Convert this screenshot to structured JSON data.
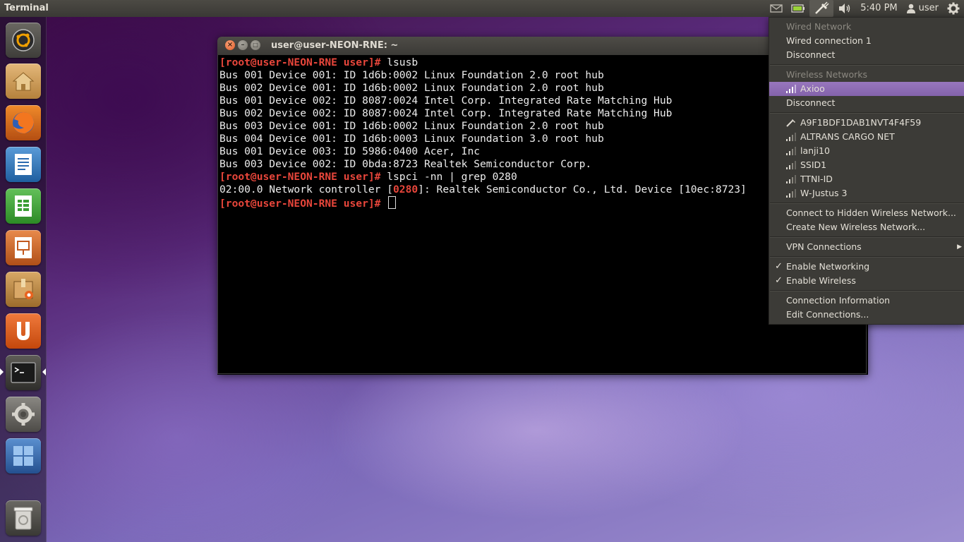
{
  "top_panel": {
    "app_title": "Terminal",
    "time": "5:40 PM",
    "user": "user",
    "icons": [
      "mail-icon",
      "battery-icon",
      "network-icon",
      "volume-icon",
      "user-icon",
      "gear-icon"
    ]
  },
  "launcher": {
    "items": [
      {
        "name": "dash-home",
        "icon": "ubuntu-logo-icon"
      },
      {
        "name": "home-folder",
        "icon": "home-folder-icon"
      },
      {
        "name": "firefox",
        "icon": "firefox-icon"
      },
      {
        "name": "libreoffice-writer",
        "icon": "writer-icon"
      },
      {
        "name": "libreoffice-calc",
        "icon": "calc-icon"
      },
      {
        "name": "libreoffice-impress",
        "icon": "impress-icon"
      },
      {
        "name": "software-center",
        "icon": "software-center-icon"
      },
      {
        "name": "ubuntu-one",
        "icon": "ubuntu-one-icon"
      },
      {
        "name": "terminal",
        "icon": "terminal-icon"
      },
      {
        "name": "system-settings",
        "icon": "settings-icon"
      },
      {
        "name": "workspace-switcher",
        "icon": "workspaces-icon"
      },
      {
        "name": "trash",
        "icon": "trash-icon"
      }
    ]
  },
  "terminal": {
    "title": "user@user-NEON-RNE: ~",
    "lines": [
      {
        "prompt": "[root@user-NEON-RNE user]#",
        "text": " lsusb"
      },
      {
        "text": "Bus 001 Device 001: ID 1d6b:0002 Linux Foundation 2.0 root hub"
      },
      {
        "text": "Bus 002 Device 001: ID 1d6b:0002 Linux Foundation 2.0 root hub"
      },
      {
        "text": "Bus 001 Device 002: ID 8087:0024 Intel Corp. Integrated Rate Matching Hub"
      },
      {
        "text": "Bus 002 Device 002: ID 8087:0024 Intel Corp. Integrated Rate Matching Hub"
      },
      {
        "text": "Bus 003 Device 001: ID 1d6b:0002 Linux Foundation 2.0 root hub"
      },
      {
        "text": "Bus 004 Device 001: ID 1d6b:0003 Linux Foundation 3.0 root hub"
      },
      {
        "text": "Bus 001 Device 003: ID 5986:0400 Acer, Inc"
      },
      {
        "text": "Bus 003 Device 002: ID 0bda:8723 Realtek Semiconductor Corp."
      },
      {
        "prompt": "[root@user-NEON-RNE user]#",
        "text": " lspci -nn | grep 0280"
      },
      {
        "pre": "02:00.0 Network controller [",
        "highlight": "0280",
        "post": "]: Realtek Semiconductor Co., Ltd. Device [10ec:8723]"
      },
      {
        "prompt": "[root@user-NEON-RNE user]#",
        "text": " "
      }
    ]
  },
  "network_menu": {
    "wired_header": "Wired Network",
    "wired_connection": "Wired connection 1",
    "wired_disconnect": "Disconnect",
    "wireless_header": "Wireless Networks",
    "active_network": "Axioo",
    "wireless_disconnect": "Disconnect",
    "networks": [
      "A9F1BDF1DAB1NVT4F4F59",
      "ALTRANS CARGO NET",
      "lanji10",
      "SSID1",
      "TTNI-ID",
      "W-Justus 3"
    ],
    "connect_hidden": "Connect to Hidden Wireless Network...",
    "create_new": "Create New Wireless Network...",
    "vpn": "VPN Connections",
    "enable_networking": "Enable Networking",
    "enable_wireless": "Enable Wireless",
    "connection_info": "Connection Information",
    "edit_connections": "Edit Connections..."
  },
  "colors": {
    "accent": "#8f6fb6",
    "prompt": "#e8463b",
    "panel": "#3c3b37"
  }
}
